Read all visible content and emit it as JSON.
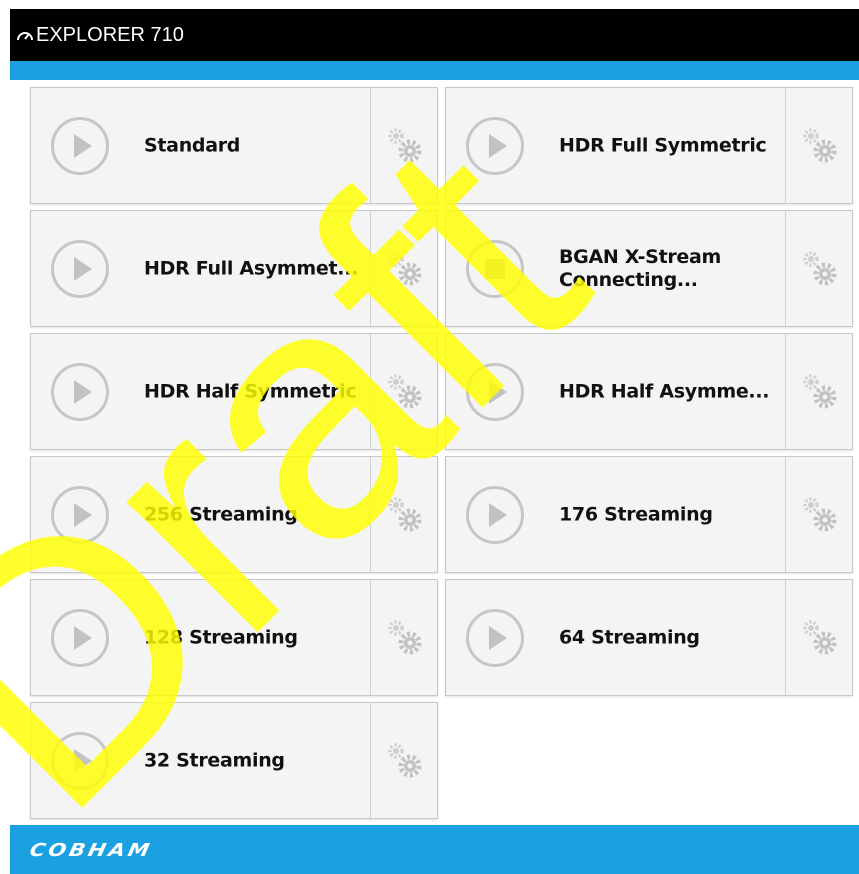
{
  "header": {
    "title": "EXPLORER 710",
    "icon": "gauge-icon",
    "background": "#000000",
    "accent": "#1ba1e2"
  },
  "tiles": [
    {
      "label": "Standard",
      "state": "idle",
      "action_icon": "play-icon"
    },
    {
      "label": "HDR Full Symmetric",
      "state": "idle",
      "action_icon": "play-icon"
    },
    {
      "label": "HDR Full Asymmet...",
      "state": "idle",
      "action_icon": "play-icon"
    },
    {
      "label": "BGAN X-Stream",
      "label_line2": "Connecting...",
      "state": "connecting",
      "action_icon": "stop-icon"
    },
    {
      "label": "HDR Half Symmetric",
      "state": "idle",
      "action_icon": "play-icon"
    },
    {
      "label": "HDR Half Asymme...",
      "state": "idle",
      "action_icon": "play-icon"
    },
    {
      "label": "256 Streaming",
      "state": "idle",
      "action_icon": "play-icon"
    },
    {
      "label": "176 Streaming",
      "state": "idle",
      "action_icon": "play-icon"
    },
    {
      "label": "128 Streaming",
      "state": "idle",
      "action_icon": "play-icon"
    },
    {
      "label": "64 Streaming",
      "state": "idle",
      "action_icon": "play-icon"
    },
    {
      "label": "32 Streaming",
      "state": "idle",
      "action_icon": "play-icon"
    }
  ],
  "settings_icon": "gears-icon",
  "footer": {
    "logo": "COBHAM",
    "background": "#1ba1e2"
  },
  "watermark": {
    "text": "Draft",
    "color": "#ffff00"
  }
}
